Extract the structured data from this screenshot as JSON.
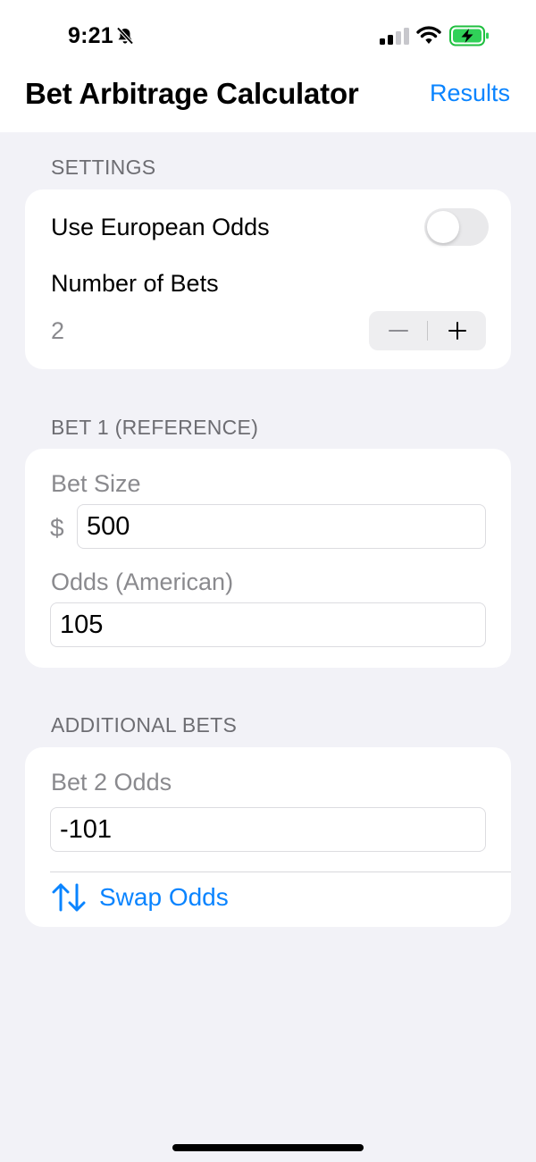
{
  "status_bar": {
    "time": "9:21"
  },
  "nav": {
    "title": "Bet Arbitrage Calculator",
    "results_label": "Results"
  },
  "settings": {
    "header": "SETTINGS",
    "european_odds_label": "Use European Odds",
    "european_odds_on": false,
    "number_of_bets_label": "Number of Bets",
    "number_of_bets_value": "2"
  },
  "bet1": {
    "header": "BET 1 (REFERENCE)",
    "bet_size_label": "Bet Size",
    "currency_symbol": "$",
    "bet_size_value": "500",
    "odds_label": "Odds (American)",
    "odds_value": "105"
  },
  "additional": {
    "header": "ADDITIONAL BETS",
    "bet2_label": "Bet 2 Odds",
    "bet2_value": "-101",
    "swap_label": "Swap Odds"
  },
  "colors": {
    "accent": "#0a84ff",
    "background": "#f2f2f7",
    "card": "#ffffff",
    "secondary_text": "#8a8a8e"
  },
  "icons": {
    "silent": "bell-slash-icon",
    "signal": "cellular-signal-icon",
    "wifi": "wifi-icon",
    "battery": "battery-charging-icon",
    "swap": "arrow-up-arrow-down-icon"
  }
}
